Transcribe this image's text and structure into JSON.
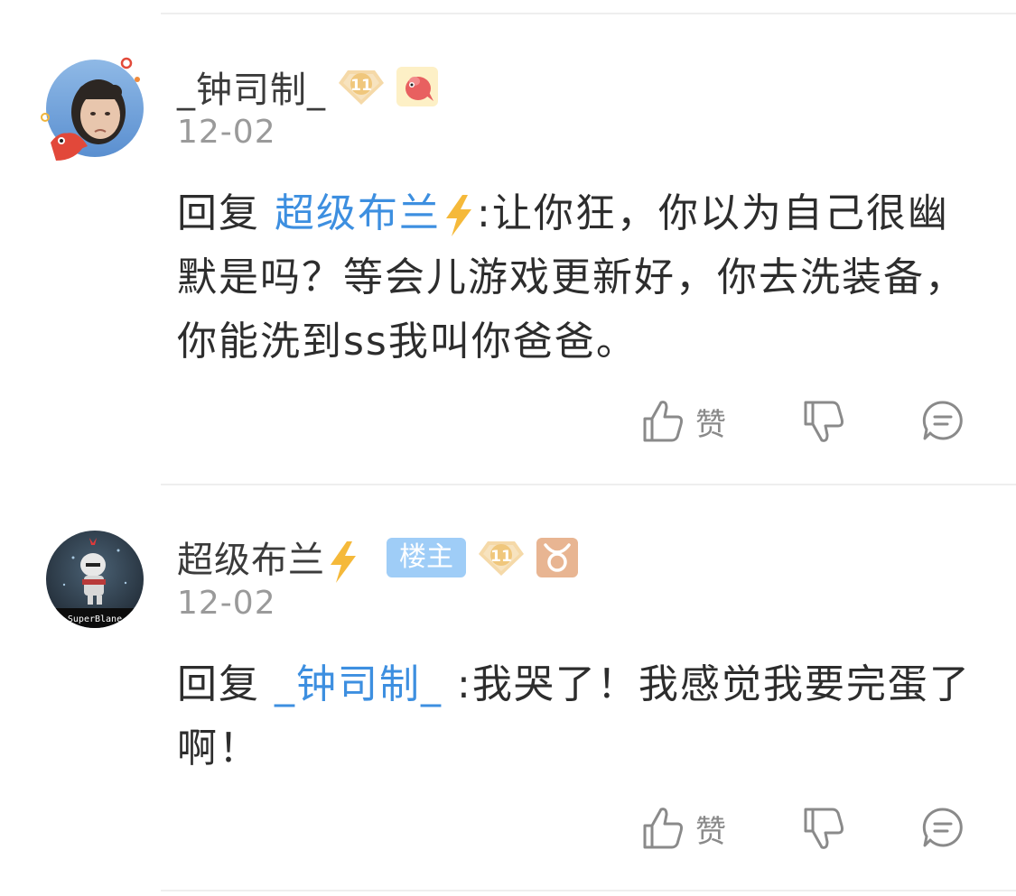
{
  "comments": [
    {
      "username": "_钟司制_",
      "level": "11",
      "date": "12-02",
      "reply_prefix": "回复",
      "reply_to": "超级布兰",
      "reply_to_has_bolt": true,
      "text": ":让你狂，你以为自己很幽默是吗？等会儿游戏更新好，你去洗装备，你能洗到ss我叫你爸爸。",
      "like_label": "赞",
      "badges": [
        "level-badge",
        "fish-badge"
      ]
    },
    {
      "username": "超级布兰",
      "owner_badge": "楼主",
      "level": "11",
      "date": "12-02",
      "reply_prefix": "回复",
      "reply_to": "_钟司制_",
      "text": ":我哭了！我感觉我要完蛋了啊！",
      "like_label": "赞",
      "avatar_caption": "SuperBlane",
      "badges": [
        "owner-badge",
        "level-badge",
        "taurus-badge"
      ]
    }
  ],
  "colors": {
    "mention": "#3d8fe0",
    "owner_badge": "#9fcdf7",
    "date": "#9a9a9a",
    "icon": "#8a8a8a",
    "level_badge": "#f5d9a8"
  },
  "icons": [
    "thumbs-up-icon",
    "thumbs-down-icon",
    "comment-icon",
    "lightning-icon",
    "taurus-icon"
  ]
}
